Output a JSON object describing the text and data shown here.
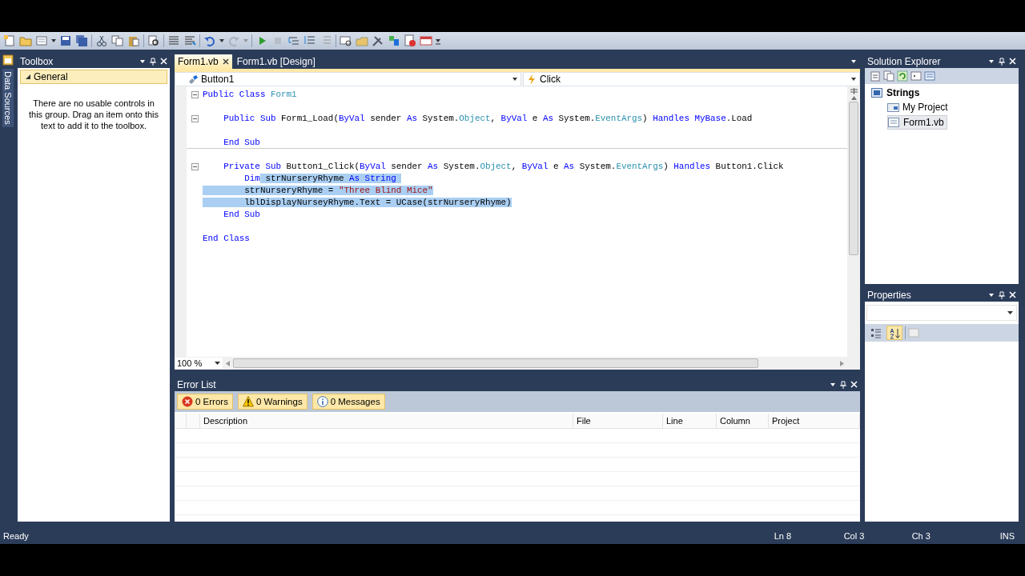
{
  "data_sources_tab": {
    "label": "Data Sources"
  },
  "toolbox": {
    "title": "Toolbox",
    "group": {
      "label": "General",
      "expanded": true
    },
    "message": "There are no usable controls in this group. Drag an item onto this text to add it to the toolbox."
  },
  "editor": {
    "tabs": [
      {
        "label": "Form1.vb",
        "selected": true
      },
      {
        "label": "Form1.vb [Design]",
        "selected": false
      }
    ],
    "object_dropdown": "Button1",
    "event_dropdown": "Click",
    "lines": [
      {
        "kind": "code",
        "fold": true,
        "divider": false,
        "tokens": [
          {
            "text": "Public Class ",
            "kind": "keyword",
            "highlighted": false
          },
          {
            "text": "Form1",
            "kind": "type",
            "highlighted": false
          }
        ]
      },
      {
        "kind": "blank"
      },
      {
        "kind": "code",
        "fold": true,
        "divider": false,
        "tokens": [
          {
            "text": "    Public Sub ",
            "kind": "keyword",
            "highlighted": false
          },
          {
            "text": "Form1_Load(",
            "kind": "plain",
            "highlighted": false
          },
          {
            "text": "ByVal",
            "kind": "keyword",
            "highlighted": false
          },
          {
            "text": " sender ",
            "kind": "plain",
            "highlighted": false
          },
          {
            "text": "As",
            "kind": "keyword",
            "highlighted": false
          },
          {
            "text": " System.",
            "kind": "plain",
            "highlighted": false
          },
          {
            "text": "Object",
            "kind": "type",
            "highlighted": false
          },
          {
            "text": ", ",
            "kind": "plain",
            "highlighted": false
          },
          {
            "text": "ByVal",
            "kind": "keyword",
            "highlighted": false
          },
          {
            "text": " e ",
            "kind": "plain",
            "highlighted": false
          },
          {
            "text": "As",
            "kind": "keyword",
            "highlighted": false
          },
          {
            "text": " System.",
            "kind": "plain",
            "highlighted": false
          },
          {
            "text": "EventArgs",
            "kind": "type",
            "highlighted": false
          },
          {
            "text": ") ",
            "kind": "plain",
            "highlighted": false
          },
          {
            "text": "Handles ",
            "kind": "keyword",
            "highlighted": false
          },
          {
            "text": "MyBase",
            "kind": "keyword",
            "highlighted": false
          },
          {
            "text": ".Load",
            "kind": "plain",
            "highlighted": false
          }
        ]
      },
      {
        "kind": "blank"
      },
      {
        "kind": "code",
        "fold": false,
        "divider": true,
        "tokens": [
          {
            "text": "    End Sub",
            "kind": "keyword",
            "highlighted": false
          }
        ]
      },
      {
        "kind": "blank"
      },
      {
        "kind": "code",
        "fold": true,
        "divider": false,
        "tokens": [
          {
            "text": "    Private Sub ",
            "kind": "keyword",
            "highlighted": false
          },
          {
            "text": "Button1_Click(",
            "kind": "plain",
            "highlighted": false
          },
          {
            "text": "ByVal",
            "kind": "keyword",
            "highlighted": false
          },
          {
            "text": " sender ",
            "kind": "plain",
            "highlighted": false
          },
          {
            "text": "As",
            "kind": "keyword",
            "highlighted": false
          },
          {
            "text": " System.",
            "kind": "plain",
            "highlighted": false
          },
          {
            "text": "Object",
            "kind": "type",
            "highlighted": false
          },
          {
            "text": ", ",
            "kind": "plain",
            "highlighted": false
          },
          {
            "text": "ByVal",
            "kind": "keyword",
            "highlighted": false
          },
          {
            "text": " e ",
            "kind": "plain",
            "highlighted": false
          },
          {
            "text": "As",
            "kind": "keyword",
            "highlighted": false
          },
          {
            "text": " System.",
            "kind": "plain",
            "highlighted": false
          },
          {
            "text": "EventArgs",
            "kind": "type",
            "highlighted": false
          },
          {
            "text": ") ",
            "kind": "plain",
            "highlighted": false
          },
          {
            "text": "Handles",
            "kind": "keyword",
            "highlighted": false
          },
          {
            "text": " Button1.Click",
            "kind": "plain",
            "highlighted": false
          }
        ]
      },
      {
        "kind": "code",
        "fold": false,
        "divider": false,
        "tokens": [
          {
            "text": "        Dim",
            "kind": "keyword",
            "highlighted": false
          },
          {
            "text": " strNurseryRhyme ",
            "kind": "plain",
            "highlighted": true
          },
          {
            "text": "As String ",
            "kind": "keyword",
            "highlighted": true
          }
        ]
      },
      {
        "kind": "code",
        "fold": false,
        "divider": false,
        "tokens": [
          {
            "text": "        strNurseryRhyme = ",
            "kind": "plain",
            "highlighted": true
          },
          {
            "text": "\"Three Blind Mice\"",
            "kind": "string",
            "highlighted": true
          }
        ]
      },
      {
        "kind": "code",
        "fold": false,
        "divider": false,
        "tokens": [
          {
            "text": "        lblDisplayNurseyRhyme.Text = UCase(strNurseryRhyme)",
            "kind": "plain",
            "highlighted": true
          }
        ]
      },
      {
        "kind": "code",
        "fold": false,
        "divider": false,
        "tokens": [
          {
            "text": "    End Sub",
            "kind": "keyword",
            "highlighted": false
          }
        ]
      },
      {
        "kind": "blank"
      },
      {
        "kind": "code",
        "fold": false,
        "divider": false,
        "tokens": [
          {
            "text": "End Class",
            "kind": "keyword",
            "highlighted": false
          }
        ]
      }
    ],
    "zoom": "100 %"
  },
  "error_list": {
    "title": "Error List",
    "filters": [
      {
        "kind": "error",
        "label": "0 Errors",
        "on": true
      },
      {
        "kind": "warning",
        "label": "0 Warnings",
        "on": true
      },
      {
        "kind": "info",
        "label": "0 Messages",
        "on": true
      }
    ],
    "columns": [
      "Description",
      "File",
      "Line",
      "Column",
      "Project"
    ]
  },
  "solution_explorer": {
    "title": "Solution Explorer",
    "tree": [
      {
        "label": "Strings",
        "kind": "solution",
        "selected": false,
        "children": [
          {
            "label": "My Project",
            "kind": "project",
            "selected": false
          },
          {
            "label": "Form1.vb",
            "kind": "form",
            "selected": true
          }
        ]
      }
    ]
  },
  "properties": {
    "title": "Properties",
    "sort_buttons": [
      {
        "kind": "categorized",
        "selected": false
      },
      {
        "kind": "alphabetical",
        "selected": true
      }
    ]
  },
  "status_bar": {
    "message": "Ready",
    "line": "Ln 8",
    "column": "Col 3",
    "char": "Ch 3",
    "mode": "INS"
  }
}
